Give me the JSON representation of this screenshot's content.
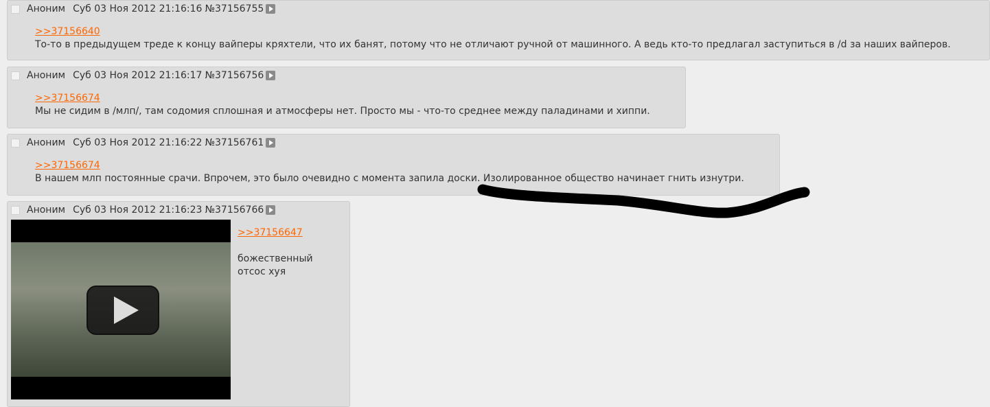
{
  "posts": [
    {
      "author": "Аноним",
      "date": "Суб 03 Ноя 2012 21:16:16",
      "number": "№37156755",
      "reply": ">>37156640",
      "text": "То-то в предыдущем треде к концу вайперы кряхтели, что их банят, потому что не отличают ручной от машинного. А ведь кто-то предлагал заступиться в /d за наших вайперов."
    },
    {
      "author": "Аноним",
      "date": "Суб 03 Ноя 2012 21:16:17",
      "number": "№37156756",
      "reply": ">>37156674",
      "text": "Мы не сидим в /млп/, там содомия сплошная и атмосферы нет. Просто мы - что-то среднее между паладинами и хиппи."
    },
    {
      "author": "Аноним",
      "date": "Суб 03 Ноя 2012 21:16:22",
      "number": "№37156761",
      "reply": ">>37156674",
      "text": "В нашем млп постоянные срачи. Впрочем, это было очевидно с момента запила доски. Изолированное общество начинает гнить изнутри."
    },
    {
      "author": "Аноним",
      "date": "Суб 03 Ноя 2012 21:16:23",
      "number": "№37156766",
      "reply": ">>37156647",
      "text_line1": "божественный",
      "text_line2": "отсос хуя"
    }
  ],
  "colors": {
    "background": "#eeeeee",
    "post_bg": "#dddddd",
    "link": "#ff6600",
    "text": "#333333"
  },
  "icons": {
    "expand": "play-triangle-icon",
    "video": "play-button-icon"
  }
}
